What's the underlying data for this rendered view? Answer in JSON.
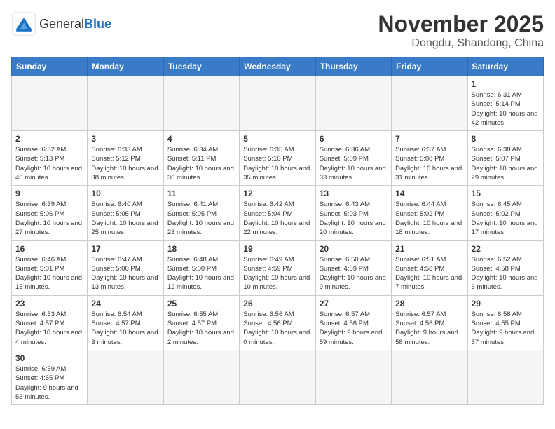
{
  "header": {
    "logo_general": "General",
    "logo_blue": "Blue",
    "month_title": "November 2025",
    "location": "Dongdu, Shandong, China"
  },
  "weekdays": [
    "Sunday",
    "Monday",
    "Tuesday",
    "Wednesday",
    "Thursday",
    "Friday",
    "Saturday"
  ],
  "weeks": [
    [
      {
        "day": "",
        "empty": true
      },
      {
        "day": "",
        "empty": true
      },
      {
        "day": "",
        "empty": true
      },
      {
        "day": "",
        "empty": true
      },
      {
        "day": "",
        "empty": true
      },
      {
        "day": "",
        "empty": true
      },
      {
        "day": "1",
        "sunrise": "6:31 AM",
        "sunset": "5:14 PM",
        "daylight": "10 hours and 42 minutes."
      }
    ],
    [
      {
        "day": "2",
        "sunrise": "6:32 AM",
        "sunset": "5:13 PM",
        "daylight": "10 hours and 40 minutes."
      },
      {
        "day": "3",
        "sunrise": "6:33 AM",
        "sunset": "5:12 PM",
        "daylight": "10 hours and 38 minutes."
      },
      {
        "day": "4",
        "sunrise": "6:34 AM",
        "sunset": "5:11 PM",
        "daylight": "10 hours and 36 minutes."
      },
      {
        "day": "5",
        "sunrise": "6:35 AM",
        "sunset": "5:10 PM",
        "daylight": "10 hours and 35 minutes."
      },
      {
        "day": "6",
        "sunrise": "6:36 AM",
        "sunset": "5:09 PM",
        "daylight": "10 hours and 33 minutes."
      },
      {
        "day": "7",
        "sunrise": "6:37 AM",
        "sunset": "5:08 PM",
        "daylight": "10 hours and 31 minutes."
      },
      {
        "day": "8",
        "sunrise": "6:38 AM",
        "sunset": "5:07 PM",
        "daylight": "10 hours and 29 minutes."
      }
    ],
    [
      {
        "day": "9",
        "sunrise": "6:39 AM",
        "sunset": "5:06 PM",
        "daylight": "10 hours and 27 minutes."
      },
      {
        "day": "10",
        "sunrise": "6:40 AM",
        "sunset": "5:05 PM",
        "daylight": "10 hours and 25 minutes."
      },
      {
        "day": "11",
        "sunrise": "6:41 AM",
        "sunset": "5:05 PM",
        "daylight": "10 hours and 23 minutes."
      },
      {
        "day": "12",
        "sunrise": "6:42 AM",
        "sunset": "5:04 PM",
        "daylight": "10 hours and 22 minutes."
      },
      {
        "day": "13",
        "sunrise": "6:43 AM",
        "sunset": "5:03 PM",
        "daylight": "10 hours and 20 minutes."
      },
      {
        "day": "14",
        "sunrise": "6:44 AM",
        "sunset": "5:02 PM",
        "daylight": "10 hours and 18 minutes."
      },
      {
        "day": "15",
        "sunrise": "6:45 AM",
        "sunset": "5:02 PM",
        "daylight": "10 hours and 17 minutes."
      }
    ],
    [
      {
        "day": "16",
        "sunrise": "6:46 AM",
        "sunset": "5:01 PM",
        "daylight": "10 hours and 15 minutes."
      },
      {
        "day": "17",
        "sunrise": "6:47 AM",
        "sunset": "5:00 PM",
        "daylight": "10 hours and 13 minutes."
      },
      {
        "day": "18",
        "sunrise": "6:48 AM",
        "sunset": "5:00 PM",
        "daylight": "10 hours and 12 minutes."
      },
      {
        "day": "19",
        "sunrise": "6:49 AM",
        "sunset": "4:59 PM",
        "daylight": "10 hours and 10 minutes."
      },
      {
        "day": "20",
        "sunrise": "6:50 AM",
        "sunset": "4:59 PM",
        "daylight": "10 hours and 9 minutes."
      },
      {
        "day": "21",
        "sunrise": "6:51 AM",
        "sunset": "4:58 PM",
        "daylight": "10 hours and 7 minutes."
      },
      {
        "day": "22",
        "sunrise": "6:52 AM",
        "sunset": "4:58 PM",
        "daylight": "10 hours and 6 minutes."
      }
    ],
    [
      {
        "day": "23",
        "sunrise": "6:53 AM",
        "sunset": "4:57 PM",
        "daylight": "10 hours and 4 minutes."
      },
      {
        "day": "24",
        "sunrise": "6:54 AM",
        "sunset": "4:57 PM",
        "daylight": "10 hours and 3 minutes."
      },
      {
        "day": "25",
        "sunrise": "6:55 AM",
        "sunset": "4:57 PM",
        "daylight": "10 hours and 2 minutes."
      },
      {
        "day": "26",
        "sunrise": "6:56 AM",
        "sunset": "4:56 PM",
        "daylight": "10 hours and 0 minutes."
      },
      {
        "day": "27",
        "sunrise": "6:57 AM",
        "sunset": "4:56 PM",
        "daylight": "9 hours and 59 minutes."
      },
      {
        "day": "28",
        "sunrise": "6:57 AM",
        "sunset": "4:56 PM",
        "daylight": "9 hours and 58 minutes."
      },
      {
        "day": "29",
        "sunrise": "6:58 AM",
        "sunset": "4:55 PM",
        "daylight": "9 hours and 57 minutes."
      }
    ],
    [
      {
        "day": "30",
        "sunrise": "6:59 AM",
        "sunset": "4:55 PM",
        "daylight": "9 hours and 55 minutes."
      },
      {
        "day": "",
        "empty": true
      },
      {
        "day": "",
        "empty": true
      },
      {
        "day": "",
        "empty": true
      },
      {
        "day": "",
        "empty": true
      },
      {
        "day": "",
        "empty": true
      },
      {
        "day": "",
        "empty": true
      }
    ]
  ]
}
